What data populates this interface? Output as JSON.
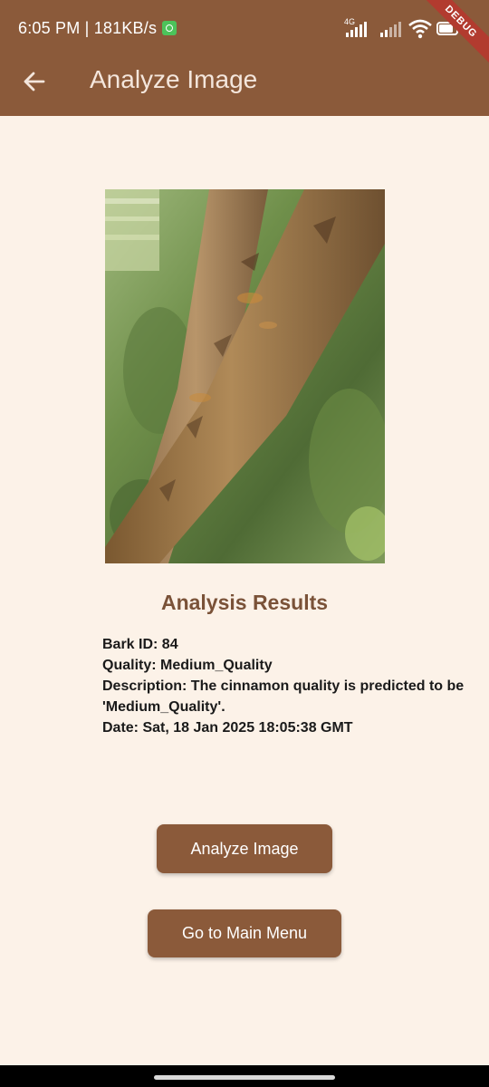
{
  "status_bar": {
    "time": "6:05 PM | 181KB/s",
    "network_label": "4G",
    "battery_level": "78"
  },
  "debug_ribbon": "DEBUG",
  "app_bar": {
    "title": "Analyze Image"
  },
  "results": {
    "heading": "Analysis Results",
    "bark_id": "Bark ID: 84",
    "quality": "Quality: Medium_Quality",
    "description": "Description: The cinnamon quality is predicted to be 'Medium_Quality'.",
    "date": "Date: Sat, 18 Jan 2025 18:05:38 GMT"
  },
  "buttons": {
    "analyze_label": "Analyze Image",
    "main_menu_label": "Go to Main Menu"
  },
  "colors": {
    "app_bar": "#8b5a3a",
    "background": "#fcf2e8",
    "heading": "#7a5238",
    "button": "#8b5a3a"
  }
}
